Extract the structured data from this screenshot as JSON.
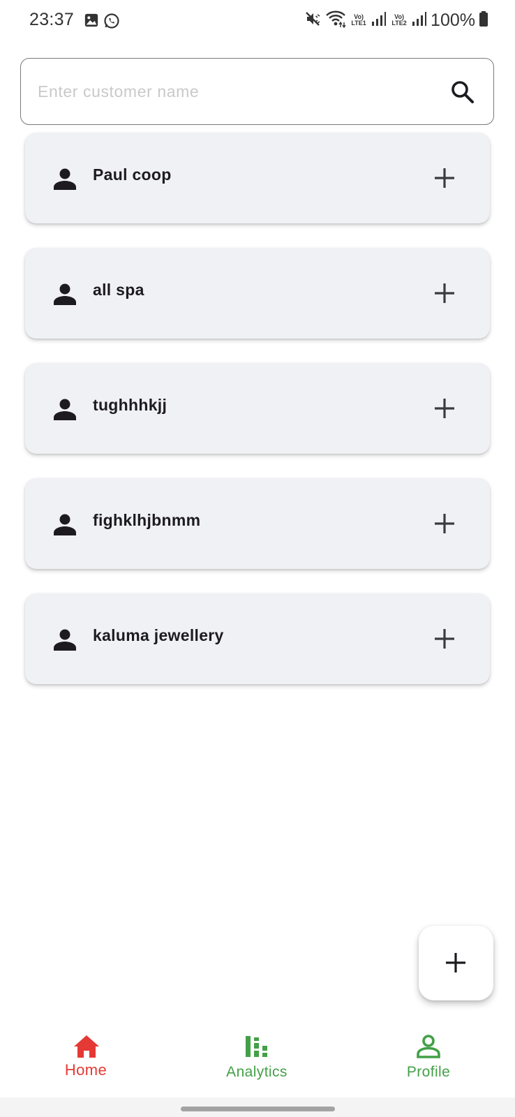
{
  "status_bar": {
    "time": "23:37",
    "lte1": "Vo) LTE1",
    "lte2": "Vo) LTE2",
    "battery_percent": "100%",
    "icons": [
      "gallery-icon",
      "whatsapp-icon",
      "mute-icon",
      "wifi-icon",
      "signal-icon",
      "battery-icon"
    ]
  },
  "search": {
    "placeholder": "Enter customer name",
    "value": "",
    "icon": "search-icon"
  },
  "customers": [
    {
      "name": "Paul coop"
    },
    {
      "name": "all spa"
    },
    {
      "name": "tughhhkjj"
    },
    {
      "name": "fighklhjbnmm"
    },
    {
      "name": "kaluma jewellery"
    }
  ],
  "fab": {
    "icon": "plus-icon"
  },
  "bottom_nav": {
    "items": [
      {
        "label": "Home",
        "icon": "home-icon",
        "active": true,
        "color": "#e53935"
      },
      {
        "label": "Analytics",
        "icon": "analytics-icon",
        "active": false,
        "color": "#43a047"
      },
      {
        "label": "Profile",
        "icon": "profile-icon",
        "active": false,
        "color": "#43a047"
      }
    ]
  },
  "colors": {
    "card_background": "#f0f1f4",
    "active_nav": "#e53935",
    "inactive_nav": "#43a047"
  }
}
